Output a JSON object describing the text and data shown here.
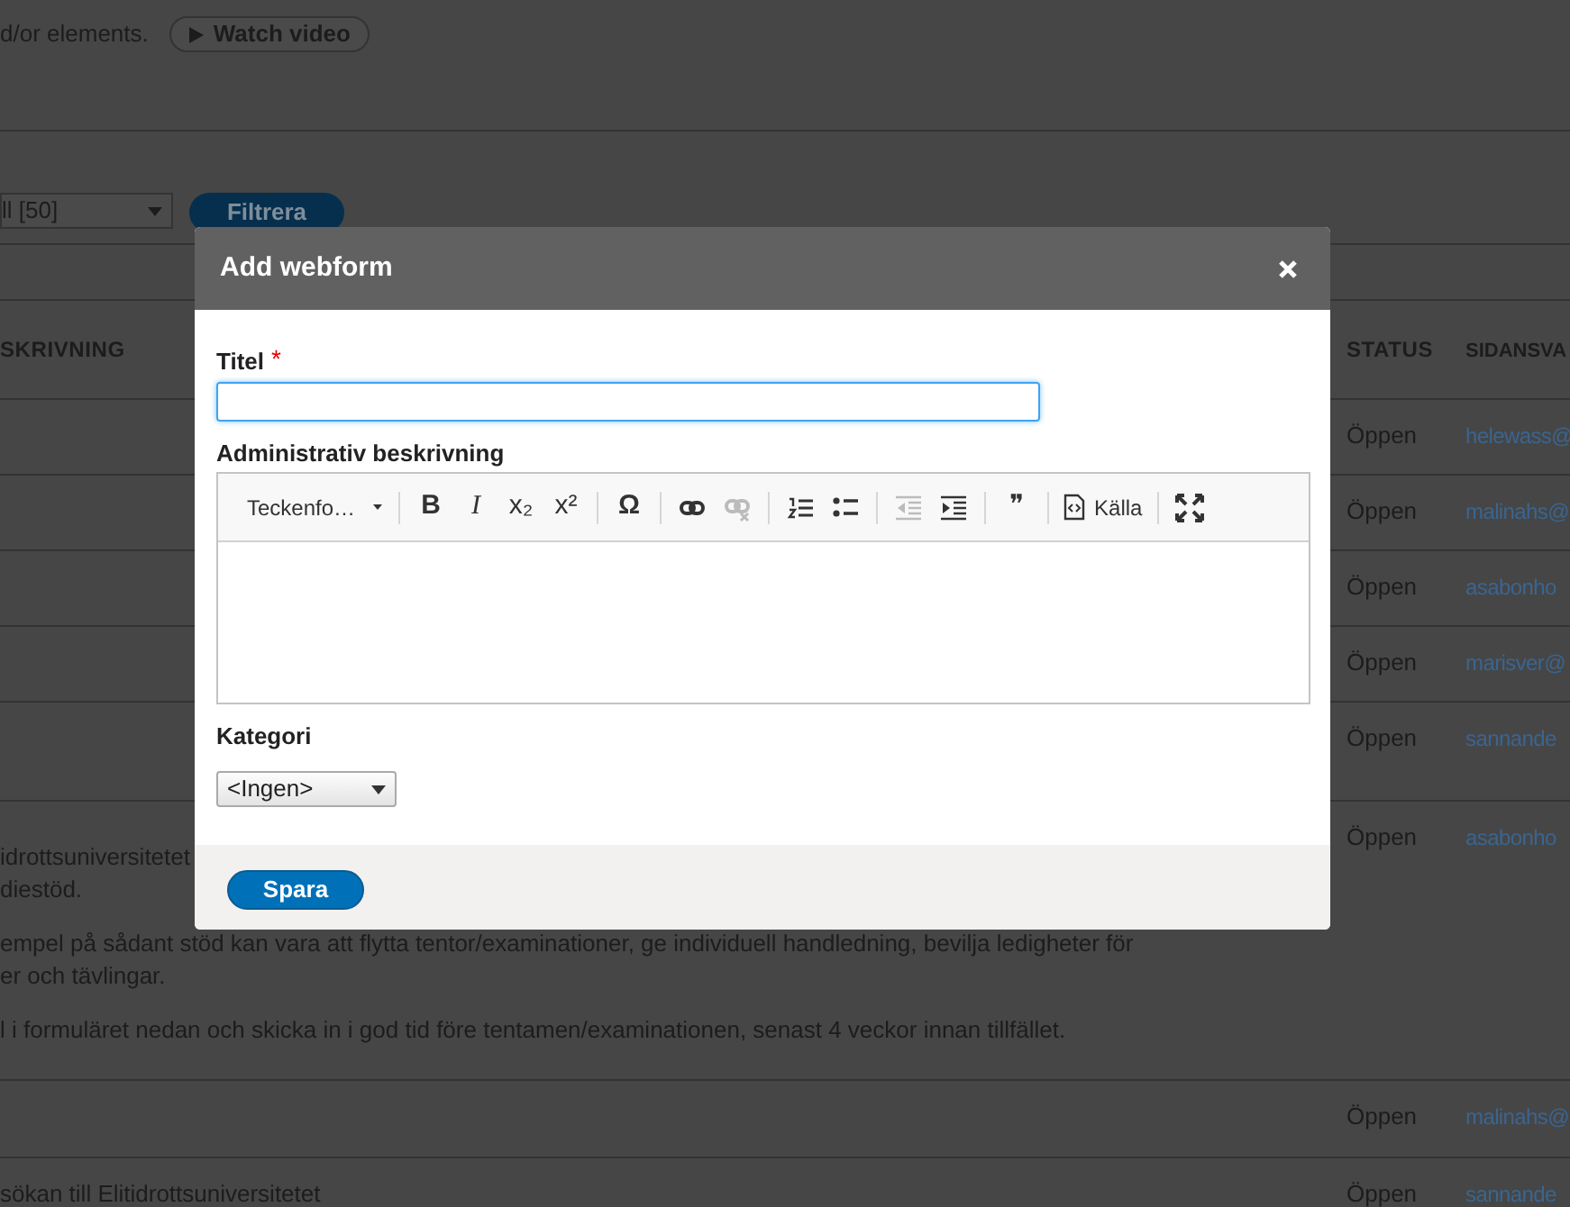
{
  "page": {
    "intro_text": "d/or elements.",
    "watch_video_button": "Watch video",
    "filter_select": "ll [50]",
    "filter_button": "Filtrera"
  },
  "table": {
    "columns": [
      "SKRIVNING",
      "STATUS",
      "SIDANSVA"
    ],
    "rows": [
      {
        "description": [],
        "status": "Öppen",
        "owner": "helewass@"
      },
      {
        "description": [],
        "status": "Öppen",
        "owner": "malinahs@"
      },
      {
        "description": [],
        "status": "Öppen",
        "owner": "asabonho"
      },
      {
        "description": [],
        "status": "Öppen",
        "owner": "marisver@"
      },
      {
        "description": [],
        "status": "Öppen",
        "owner": "sannande"
      },
      {
        "description": [
          [
            "idrottsuniversitetet",
            "diestöd."
          ],
          [
            "empel på sådant stöd kan vara att flytta tentor/examinationer, ge individuell handledning, bevilja ledigheter för",
            "er och tävlingar."
          ],
          [
            "l i formuläret nedan och skicka in i god tid före tentamen/examinationen, senast 4 veckor innan tillfället."
          ]
        ],
        "status": "Öppen",
        "owner": "asabonho"
      },
      {
        "description": [],
        "status": "Öppen",
        "owner": "malinahs@"
      },
      {
        "description": [
          [
            "sökan till Elitidrottsuniversitetet"
          ]
        ],
        "status": "Öppen",
        "owner": "sannande"
      }
    ]
  },
  "dialog": {
    "title": "Add webform",
    "title_label": "Titel",
    "required_mark": "*",
    "description_label": "Administrativ beskrivning",
    "toolbar": [
      {
        "kind": "dropdown",
        "label": "Teckenfo…"
      },
      {
        "kind": "separator"
      },
      {
        "kind": "glyph",
        "glyph": "B",
        "disabled": false
      },
      {
        "kind": "glyph",
        "glyph": "I",
        "disabled": false
      },
      {
        "kind": "glyph",
        "glyph": "x₂",
        "disabled": false
      },
      {
        "kind": "glyph",
        "glyph": "x²",
        "disabled": false
      },
      {
        "kind": "separator"
      },
      {
        "kind": "glyph",
        "glyph": "Ω",
        "disabled": false
      },
      {
        "kind": "separator"
      },
      {
        "kind": "icon",
        "disabled": false
      },
      {
        "kind": "icon",
        "disabled": true
      },
      {
        "kind": "separator"
      },
      {
        "kind": "icon",
        "disabled": false
      },
      {
        "kind": "icon",
        "disabled": false
      },
      {
        "kind": "separator"
      },
      {
        "kind": "icon",
        "disabled": true
      },
      {
        "kind": "icon",
        "disabled": false
      },
      {
        "kind": "separator"
      },
      {
        "kind": "glyph",
        "glyph": "❞",
        "disabled": false
      },
      {
        "kind": "separator"
      },
      {
        "kind": "source",
        "label": "Källa"
      },
      {
        "kind": "separator"
      },
      {
        "kind": "icon",
        "disabled": false
      }
    ],
    "category_label": "Kategori",
    "category_value": "<Ingen>",
    "save_button": "Spara"
  }
}
